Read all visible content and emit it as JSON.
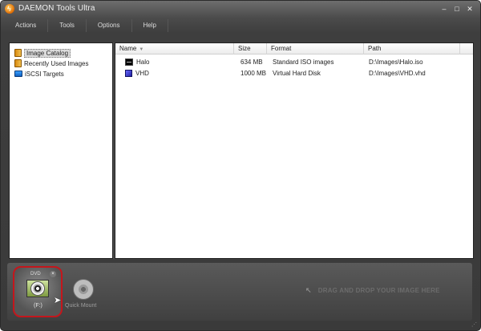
{
  "window": {
    "title": "DAEMON Tools Ultra",
    "controls": {
      "minimize": "–",
      "maximize": "□",
      "close": "✕"
    }
  },
  "menu": [
    {
      "label": "Actions"
    },
    {
      "label": "Tools"
    },
    {
      "label": "Options"
    },
    {
      "label": "Help"
    }
  ],
  "tree": {
    "items": [
      {
        "label": "Image Catalog",
        "icon": "image-catalog-icon",
        "selected": true
      },
      {
        "label": "Recently Used Images",
        "icon": "recent-images-icon",
        "selected": false
      },
      {
        "label": "iSCSI Targets",
        "icon": "iscsi-icon",
        "selected": false
      }
    ]
  },
  "list": {
    "columns": {
      "name": "Name",
      "size": "Size",
      "format": "Format",
      "path": "Path"
    },
    "rows": [
      {
        "name": "Halo",
        "size": "634 MB",
        "format": "Standard ISO images",
        "path": "D:\\Images\\Halo.iso",
        "icon": "iso-image-icon"
      },
      {
        "name": "VHD",
        "size": "1000 MB",
        "format": "Virtual Hard Disk",
        "path": "D:\\Images\\VHD.vhd",
        "icon": "vhd-image-icon"
      }
    ]
  },
  "bottom": {
    "drive": {
      "type": "DVD",
      "letter": "(F:)",
      "eject": "×"
    },
    "quick_mount": "Quick Mount",
    "dropzone": "DRAG AND DROP YOUR IMAGE HERE"
  },
  "colors": {
    "highlight_ring": "#c4161c",
    "chrome": "#3e3e3e"
  }
}
